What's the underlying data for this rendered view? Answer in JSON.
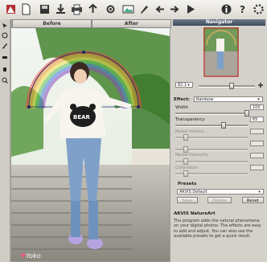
{
  "canvas": {
    "before_tab": "Before",
    "after_tab": "After",
    "watermark": "Yoko",
    "sweater_text": "BEAR"
  },
  "navigator": {
    "title": "Navigator",
    "zoom_value": "82.1"
  },
  "effect": {
    "label": "Effect:",
    "value": "Rainbow",
    "width_label": "Width",
    "width_value": "100",
    "width_level": 1.0,
    "transparency_label": "Transparency",
    "transparency_value": "65",
    "transparency_level": 0.65,
    "noise_intensity_label": "Noise Intensi...",
    "noise_intensity_value": "",
    "row5_value": "",
    "noise_intensity2_label": "Noise Intensity",
    "noise_intensity2_value": "",
    "coloration_label": "Coloration",
    "coloration_value": ""
  },
  "presets": {
    "title": "Presets",
    "selected": "AKVIS Default",
    "save_label": "Save",
    "delete_label": "Delete",
    "reset_label": "Reset"
  },
  "info": {
    "title": "AKVIS NatureArt",
    "description": "The program adds the natural phenomena on your digital photos. The effects are easy to add and adjust. You can also use the available presets to get a quick result."
  },
  "colors": {
    "panel_bg": "#d4d1ca",
    "title_bg": "#3c4a5c",
    "toolbar_bg": "#e8e6e0"
  }
}
